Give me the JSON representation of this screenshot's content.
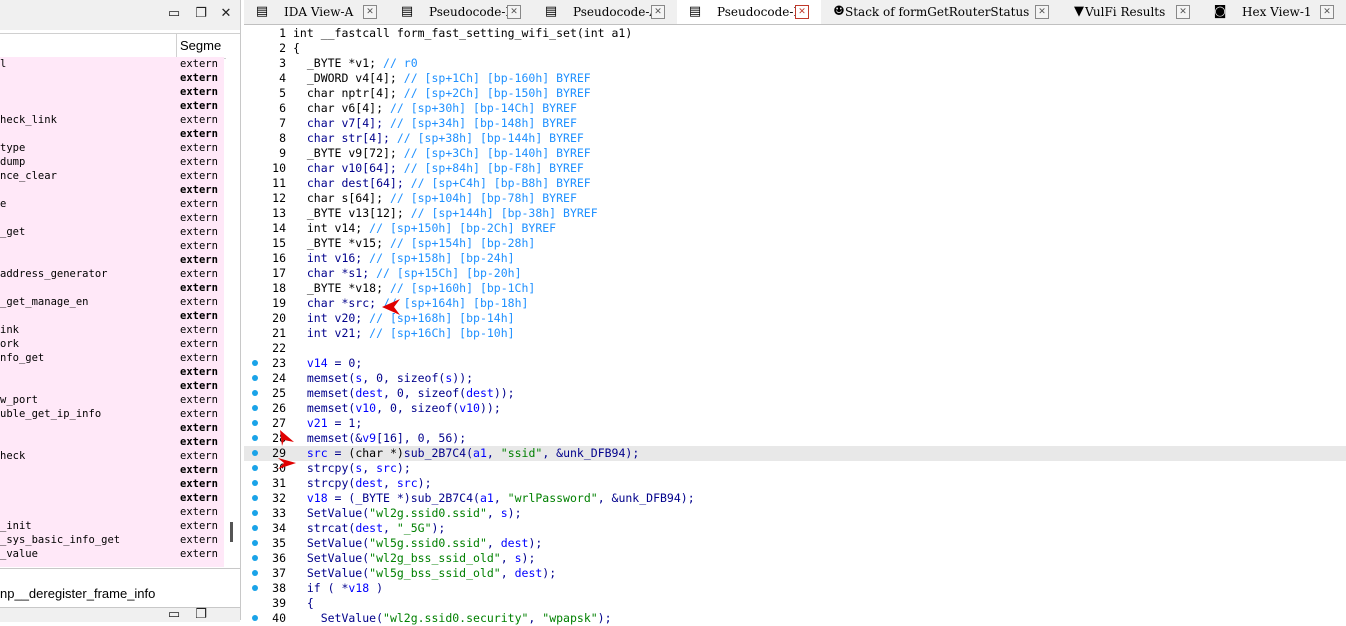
{
  "left_panel": {
    "segment_header": "Segme",
    "functions": [
      {
        "name": "l",
        "segment": "extern",
        "bold": false
      },
      {
        "name": "",
        "segment": "extern",
        "bold": true
      },
      {
        "name": "",
        "segment": "extern",
        "bold": true
      },
      {
        "name": "",
        "segment": "extern",
        "bold": true
      },
      {
        "name": "heck_link",
        "segment": "extern",
        "bold": false
      },
      {
        "name": "",
        "segment": "extern",
        "bold": true
      },
      {
        "name": "type",
        "segment": "extern",
        "bold": false
      },
      {
        "name": "dump",
        "segment": "extern",
        "bold": false
      },
      {
        "name": "nce_clear",
        "segment": "extern",
        "bold": false
      },
      {
        "name": "",
        "segment": "extern",
        "bold": true
      },
      {
        "name": "e",
        "segment": "extern",
        "bold": false
      },
      {
        "name": "",
        "segment": "extern",
        "bold": false
      },
      {
        "name": "_get",
        "segment": "extern",
        "bold": false
      },
      {
        "name": "",
        "segment": "extern",
        "bold": false
      },
      {
        "name": "",
        "segment": "extern",
        "bold": true
      },
      {
        "name": "address_generator",
        "segment": "extern",
        "bold": false
      },
      {
        "name": "",
        "segment": "extern",
        "bold": true
      },
      {
        "name": "_get_manage_en",
        "segment": "extern",
        "bold": false
      },
      {
        "name": "",
        "segment": "extern",
        "bold": true
      },
      {
        "name": "ink",
        "segment": "extern",
        "bold": false
      },
      {
        "name": "ork",
        "segment": "extern",
        "bold": false
      },
      {
        "name": "nfo_get",
        "segment": "extern",
        "bold": false
      },
      {
        "name": "",
        "segment": "extern",
        "bold": true
      },
      {
        "name": "",
        "segment": "extern",
        "bold": true
      },
      {
        "name": "w_port",
        "segment": "extern",
        "bold": false
      },
      {
        "name": "uble_get_ip_info",
        "segment": "extern",
        "bold": false
      },
      {
        "name": "",
        "segment": "extern",
        "bold": true
      },
      {
        "name": "",
        "segment": "extern",
        "bold": true
      },
      {
        "name": "heck",
        "segment": "extern",
        "bold": false
      },
      {
        "name": "",
        "segment": "extern",
        "bold": true
      },
      {
        "name": "",
        "segment": "extern",
        "bold": true
      },
      {
        "name": "",
        "segment": "extern",
        "bold": true
      },
      {
        "name": "",
        "segment": "extern",
        "bold": false
      },
      {
        "name": "_init",
        "segment": "extern",
        "bold": false
      },
      {
        "name": "_sys_basic_info_get",
        "segment": "extern",
        "bold": false
      },
      {
        "name": "_value",
        "segment": "extern",
        "bold": false
      }
    ],
    "bottom_function": "np__deregister_frame_info"
  },
  "tabs": [
    {
      "label": "IDA View-A",
      "icon": "ida-view-icon",
      "active": false
    },
    {
      "label": "Pseudocode-E",
      "icon": "pseudocode-icon",
      "active": false
    },
    {
      "label": "Pseudocode-A",
      "icon": "pseudocode-icon",
      "active": false
    },
    {
      "label": "Pseudocode-D",
      "icon": "pseudocode-icon",
      "active": true
    },
    {
      "label": "Stack of formGetRouterStatus",
      "icon": "stack-icon",
      "active": false
    },
    {
      "label": "VulFi Results",
      "icon": "vulfi-icon",
      "active": false
    },
    {
      "label": "Hex View-1",
      "icon": "hex-view-icon",
      "active": false
    }
  ],
  "code": {
    "highlighted_line": 29,
    "lines": [
      {
        "n": "1",
        "dot": false,
        "segs": [
          [
            "",
            "int __fastcall form_fast_setting_wifi_set(int a1)"
          ]
        ]
      },
      {
        "n": "2",
        "dot": false,
        "segs": [
          [
            "",
            "{"
          ]
        ]
      },
      {
        "n": "3",
        "dot": false,
        "segs": [
          [
            "",
            "  _BYTE *v1; "
          ],
          [
            "cm",
            "// r0"
          ]
        ]
      },
      {
        "n": "4",
        "dot": false,
        "segs": [
          [
            "",
            "  _DWORD v4[4]; "
          ],
          [
            "cm",
            "// [sp+1Ch] [bp-160h] BYREF"
          ]
        ]
      },
      {
        "n": "5",
        "dot": false,
        "segs": [
          [
            "",
            "  char nptr[4]; "
          ],
          [
            "cm",
            "// [sp+2Ch] [bp-150h] BYREF"
          ]
        ]
      },
      {
        "n": "6",
        "dot": false,
        "segs": [
          [
            "",
            "  char v6[4]; "
          ],
          [
            "cm",
            "// [sp+30h] [bp-14Ch] BYREF"
          ]
        ]
      },
      {
        "n": "7",
        "dot": false,
        "segs": [
          [
            "kw",
            "  char v7[4]; "
          ],
          [
            "cm",
            "// [sp+34h] [bp-148h] BYREF"
          ]
        ]
      },
      {
        "n": "8",
        "dot": false,
        "segs": [
          [
            "kw",
            "  char str[4]; "
          ],
          [
            "cm",
            "// [sp+38h] [bp-144h] BYREF"
          ]
        ]
      },
      {
        "n": "9",
        "dot": false,
        "segs": [
          [
            "",
            "  _BYTE v9[72]; "
          ],
          [
            "cm",
            "// [sp+3Ch] [bp-140h] BYREF"
          ]
        ]
      },
      {
        "n": "10",
        "dot": false,
        "segs": [
          [
            "kw",
            "  char v10[64]; "
          ],
          [
            "cm",
            "// [sp+84h] [bp-F8h] BYREF"
          ]
        ]
      },
      {
        "n": "11",
        "dot": false,
        "segs": [
          [
            "kw",
            "  char dest[64]; "
          ],
          [
            "cm",
            "// [sp+C4h] [bp-B8h] BYREF"
          ]
        ]
      },
      {
        "n": "12",
        "dot": false,
        "segs": [
          [
            "",
            "  char s[64]; "
          ],
          [
            "cm",
            "// [sp+104h] [bp-78h] BYREF"
          ]
        ]
      },
      {
        "n": "13",
        "dot": false,
        "segs": [
          [
            "",
            "  _BYTE v13[12]; "
          ],
          [
            "cm",
            "// [sp+144h] [bp-38h] BYREF"
          ]
        ]
      },
      {
        "n": "14",
        "dot": false,
        "segs": [
          [
            "",
            "  int v14; "
          ],
          [
            "cm",
            "// [sp+150h] [bp-2Ch] BYREF"
          ]
        ]
      },
      {
        "n": "15",
        "dot": false,
        "segs": [
          [
            "",
            "  _BYTE *v15; "
          ],
          [
            "cm",
            "// [sp+154h] [bp-28h]"
          ]
        ]
      },
      {
        "n": "16",
        "dot": false,
        "segs": [
          [
            "kw",
            "  int v16; "
          ],
          [
            "cm",
            "// [sp+158h] [bp-24h]"
          ]
        ]
      },
      {
        "n": "17",
        "dot": false,
        "segs": [
          [
            "kw",
            "  char *s1; "
          ],
          [
            "cm",
            "// [sp+15Ch] [bp-20h]"
          ]
        ]
      },
      {
        "n": "18",
        "dot": false,
        "segs": [
          [
            "",
            "  _BYTE *v18; "
          ],
          [
            "cm",
            "// [sp+160h] [bp-1Ch]"
          ]
        ]
      },
      {
        "n": "19",
        "dot": false,
        "segs": [
          [
            "kw",
            "  char *src; "
          ],
          [
            "cm",
            "// [sp+164h] [bp-18h]"
          ]
        ]
      },
      {
        "n": "20",
        "dot": false,
        "segs": [
          [
            "kw",
            "  int v20; "
          ],
          [
            "cm",
            "// [sp+168h] [bp-14h]"
          ]
        ]
      },
      {
        "n": "21",
        "dot": false,
        "segs": [
          [
            "kw",
            "  int v21; "
          ],
          [
            "cm",
            "// [sp+16Ch] [bp-10h]"
          ]
        ]
      },
      {
        "n": "22",
        "dot": false,
        "segs": [
          [
            "",
            ""
          ]
        ]
      },
      {
        "n": "23",
        "dot": true,
        "segs": [
          [
            "var",
            "  v14"
          ],
          [
            "kw",
            " = 0;"
          ]
        ]
      },
      {
        "n": "24",
        "dot": true,
        "segs": [
          [
            "kw",
            "  memset("
          ],
          [
            "var",
            "s"
          ],
          [
            "kw",
            ", 0, sizeof("
          ],
          [
            "var",
            "s"
          ],
          [
            "kw",
            "));"
          ]
        ]
      },
      {
        "n": "25",
        "dot": true,
        "segs": [
          [
            "kw",
            "  memset("
          ],
          [
            "var",
            "dest"
          ],
          [
            "kw",
            ", 0, sizeof("
          ],
          [
            "var",
            "dest"
          ],
          [
            "kw",
            "));"
          ]
        ]
      },
      {
        "n": "26",
        "dot": true,
        "segs": [
          [
            "kw",
            "  memset("
          ],
          [
            "var",
            "v10"
          ],
          [
            "kw",
            ", 0, sizeof("
          ],
          [
            "var",
            "v10"
          ],
          [
            "kw",
            "));"
          ]
        ]
      },
      {
        "n": "27",
        "dot": true,
        "segs": [
          [
            "var",
            "  v21"
          ],
          [
            "kw",
            " = 1;"
          ]
        ]
      },
      {
        "n": "28",
        "dot": true,
        "segs": [
          [
            "kw",
            "  memset(&"
          ],
          [
            "var",
            "v9"
          ],
          [
            "kw",
            "[16], 0, 56);"
          ]
        ]
      },
      {
        "n": "29",
        "dot": true,
        "segs": [
          [
            "var",
            "  src"
          ],
          [
            "kw",
            " = "
          ],
          [
            "",
            "(char *)"
          ],
          [
            "kw",
            "sub_2B7C4("
          ],
          [
            "var",
            "a1"
          ],
          [
            "kw",
            ", "
          ],
          [
            "str",
            "\"ssid\""
          ],
          [
            "kw",
            ", &unk_DFB94);"
          ]
        ]
      },
      {
        "n": "30",
        "dot": true,
        "segs": [
          [
            "kw",
            "  strcpy("
          ],
          [
            "var",
            "s"
          ],
          [
            "kw",
            ", "
          ],
          [
            "var",
            "src"
          ],
          [
            "kw",
            ");"
          ]
        ]
      },
      {
        "n": "31",
        "dot": true,
        "segs": [
          [
            "kw",
            "  strcpy("
          ],
          [
            "var",
            "dest"
          ],
          [
            "kw",
            ", "
          ],
          [
            "var",
            "src"
          ],
          [
            "kw",
            ");"
          ]
        ]
      },
      {
        "n": "32",
        "dot": true,
        "segs": [
          [
            "var",
            "  v18"
          ],
          [
            "kw",
            " = (_BYTE *)sub_2B7C4("
          ],
          [
            "var",
            "a1"
          ],
          [
            "kw",
            ", "
          ],
          [
            "str",
            "\"wrlPassword\""
          ],
          [
            "kw",
            ", &unk_DFB94);"
          ]
        ]
      },
      {
        "n": "33",
        "dot": true,
        "segs": [
          [
            "kw",
            "  SetValue("
          ],
          [
            "str",
            "\"wl2g.ssid0.ssid\""
          ],
          [
            "kw",
            ", "
          ],
          [
            "var",
            "s"
          ],
          [
            "kw",
            ");"
          ]
        ]
      },
      {
        "n": "34",
        "dot": true,
        "segs": [
          [
            "kw",
            "  strcat("
          ],
          [
            "var",
            "dest"
          ],
          [
            "kw",
            ", "
          ],
          [
            "str",
            "\"_5G\""
          ],
          [
            "kw",
            ");"
          ]
        ]
      },
      {
        "n": "35",
        "dot": true,
        "segs": [
          [
            "kw",
            "  SetValue("
          ],
          [
            "str",
            "\"wl5g.ssid0.ssid\""
          ],
          [
            "kw",
            ", "
          ],
          [
            "var",
            "dest"
          ],
          [
            "kw",
            ");"
          ]
        ]
      },
      {
        "n": "36",
        "dot": true,
        "segs": [
          [
            "kw",
            "  SetValue("
          ],
          [
            "str",
            "\"wl2g_bss_ssid_old\""
          ],
          [
            "kw",
            ", "
          ],
          [
            "var",
            "s"
          ],
          [
            "kw",
            ");"
          ]
        ]
      },
      {
        "n": "37",
        "dot": true,
        "segs": [
          [
            "kw",
            "  SetValue("
          ],
          [
            "str",
            "\"wl5g_bss_ssid_old\""
          ],
          [
            "kw",
            ", "
          ],
          [
            "var",
            "dest"
          ],
          [
            "kw",
            ");"
          ]
        ]
      },
      {
        "n": "38",
        "dot": true,
        "segs": [
          [
            "kw",
            "  if ( *"
          ],
          [
            "var",
            "v18"
          ],
          [
            "kw",
            " )"
          ]
        ]
      },
      {
        "n": "39",
        "dot": false,
        "segs": [
          [
            "kw",
            "  {"
          ]
        ]
      },
      {
        "n": "40",
        "dot": true,
        "segs": [
          [
            "kw",
            "    SetValue("
          ],
          [
            "str",
            "\"wl2g.ssid0.security\""
          ],
          [
            "kw",
            ", "
          ],
          [
            "str",
            "\"wpapsk\""
          ],
          [
            "kw",
            ");"
          ]
        ]
      }
    ]
  },
  "colors": {
    "keyword": "#00008b",
    "variable": "#0000ff",
    "comment": "#1e90ff",
    "string": "#008000",
    "highlight": "#e8e8e8",
    "breakpoint_dot": "#1aa3e8",
    "annotation_arrow": "#e00000",
    "function_list_bg": "#ffe8f8"
  }
}
